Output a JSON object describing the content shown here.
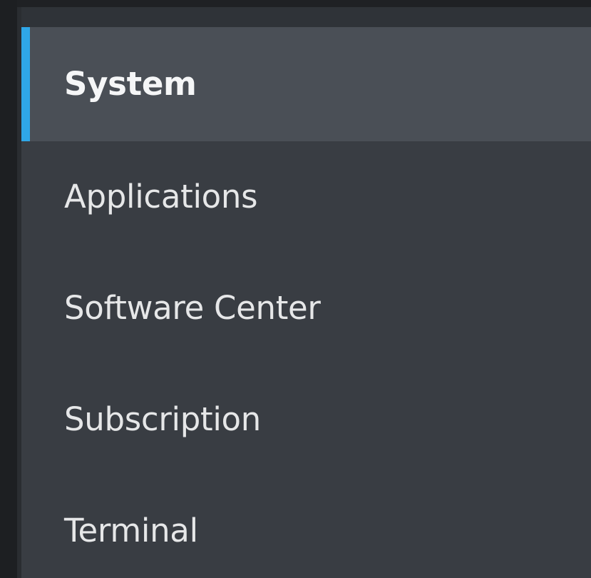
{
  "window": {
    "title": ""
  },
  "sidebar": {
    "items": [
      {
        "label": "System",
        "selected": true
      },
      {
        "label": "Applications",
        "selected": false
      },
      {
        "label": "Software Center",
        "selected": false
      },
      {
        "label": "Subscription",
        "selected": false
      },
      {
        "label": "Terminal",
        "selected": false
      }
    ],
    "accent_color": "#2fa7e8"
  }
}
